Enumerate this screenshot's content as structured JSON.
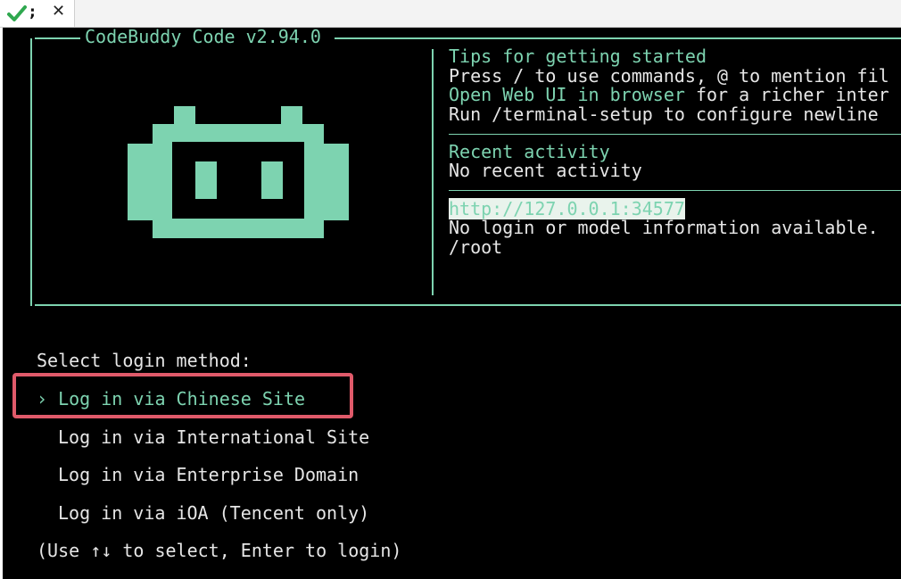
{
  "tab": {
    "title": ";",
    "close_glyph": "✕",
    "status_icon": "check-icon"
  },
  "header": {
    "app_title": "CodeBuddy Code v2.94.0"
  },
  "tips": {
    "heading": "Tips for getting started",
    "line1": "Press / to use commands, @ to mention fil",
    "line2_link": "Open Web UI in browser",
    "line2_rest": " for a richer inter",
    "line3": "Run /terminal-setup to configure newline "
  },
  "recent": {
    "heading": "Recent activity",
    "text": "No recent activity"
  },
  "server": {
    "url": "http://127.0.0.1:34577",
    "info": "No login or model information available.",
    "cwd": "/root"
  },
  "login": {
    "prompt": "Select login method:",
    "pointer": "›",
    "options": [
      "Log in via Chinese Site",
      "Log in via International Site",
      "Log in via Enterprise Domain",
      "Log in via iOA (Tencent only)"
    ],
    "hint": "(Use ↑↓ to select, Enter to login)",
    "selected_index": 0
  },
  "colors": {
    "accent": "#7dd3b0",
    "terminal_bg": "#000000",
    "text": "#e6e6e6",
    "highlight_border": "#e05a6a"
  }
}
